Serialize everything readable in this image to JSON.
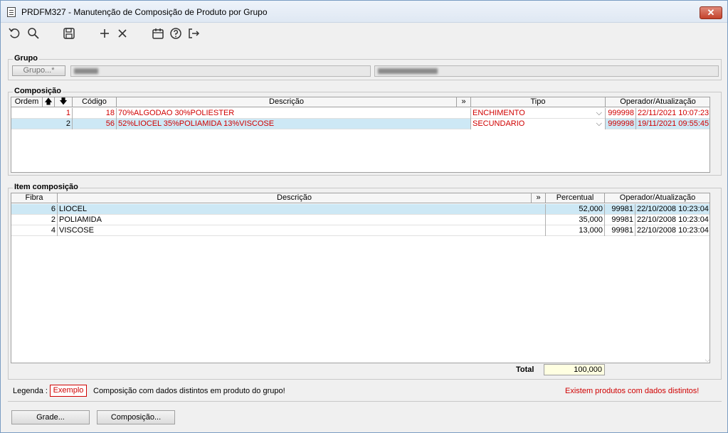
{
  "window": {
    "title": "PRDFM327 - Manutenção de Composição de Produto por Grupo",
    "close_glyph": "✕"
  },
  "toolbar": {
    "icons": [
      "undo-icon",
      "search-icon",
      "save-icon",
      "add-icon",
      "delete-icon",
      "calendar-icon",
      "help-icon",
      "exit-icon"
    ]
  },
  "grupo": {
    "title": "Grupo",
    "button_label": "Grupo...*"
  },
  "composicao": {
    "title": "Composição",
    "headers": {
      "ordem": "Ordem",
      "up": "🡅",
      "down": "🡇",
      "codigo": "Código",
      "descricao": "Descrição",
      "expand": "»",
      "tipo": "Tipo",
      "operador": "Operador/Atualização"
    },
    "rows": [
      {
        "ordem": "1",
        "codigo": "18",
        "descricao": "70%ALGODAO 30%POLIESTER",
        "tipo": "ENCHIMENTO",
        "operador": "999998",
        "data": "22/11/2021 10:07:23"
      },
      {
        "ordem": "2",
        "codigo": "56",
        "descricao": "52%LIOCEL 35%POLIAMIDA 13%VISCOSE",
        "tipo": "SECUNDARIO",
        "operador": "999998",
        "data": "19/11/2021 09:55:45"
      }
    ]
  },
  "item_composicao": {
    "title": "Item composição",
    "headers": {
      "fibra": "Fibra",
      "descricao": "Descrição",
      "expand": "»",
      "percentual": "Percentual",
      "operador": "Operador/Atualização"
    },
    "rows": [
      {
        "fibra": "6",
        "descricao": "LIOCEL",
        "percentual": "52,000",
        "operador": "99981",
        "data": "22/10/2008 10:23:04"
      },
      {
        "fibra": "2",
        "descricao": "POLIAMIDA",
        "percentual": "35,000",
        "operador": "99981",
        "data": "22/10/2008 10:23:04"
      },
      {
        "fibra": "4",
        "descricao": "VISCOSE",
        "percentual": "13,000",
        "operador": "99981",
        "data": "22/10/2008 10:23:04"
      }
    ],
    "total_label": "Total",
    "total_value": "100,000"
  },
  "legenda": {
    "label": "Legenda :",
    "sample": "Exemplo",
    "description": "Composição com dados distintos em produto do grupo!",
    "warning": "Existem produtos com dados distintos!"
  },
  "footer": {
    "grade_button": "Grade...",
    "composicao_button": "Composição..."
  },
  "colors": {
    "accent_red": "#d00000",
    "selection": "#cde8f5"
  }
}
